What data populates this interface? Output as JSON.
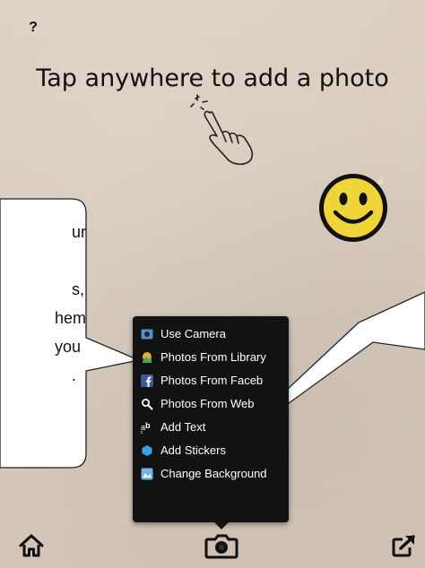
{
  "help": {
    "label": "?"
  },
  "instruction": {
    "text": "Tap anywhere to add a photo"
  },
  "callout": {
    "lines": [
      "ur",
      "",
      "s,",
      "hem",
      "you",
      "."
    ]
  },
  "menu": {
    "items": [
      {
        "label": "Use Camera",
        "icon": "camera-icon"
      },
      {
        "label": "Photos From Library",
        "icon": "photo-library-icon"
      },
      {
        "label": "Photos From Faceb",
        "icon": "facebook-icon"
      },
      {
        "label": "Photos From Web",
        "icon": "search-icon"
      },
      {
        "label": "Add Text",
        "icon": "text-icon"
      },
      {
        "label": "Add Stickers",
        "icon": "sticker-icon"
      },
      {
        "label": "Change Background",
        "icon": "background-icon"
      }
    ]
  },
  "toolbar": {
    "home": "home-icon",
    "camera": "camera-icon",
    "share": "share-icon"
  },
  "colors": {
    "background": "#d6c8ba",
    "menu": "#121212",
    "smiley": "#f0d53a"
  }
}
